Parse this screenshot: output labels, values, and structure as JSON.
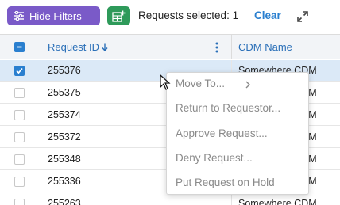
{
  "toolbar": {
    "hide_filters_label": "Hide Filters",
    "requests_selected_label": "Requests selected: 1",
    "clear_label": "Clear"
  },
  "grid": {
    "columns": [
      "Request ID",
      "CDM Name"
    ],
    "rows": [
      {
        "id": "255376",
        "cdm": "Somewhere CDM",
        "selected": true
      },
      {
        "id": "255375",
        "cdm": "Somewhere CDM",
        "selected": false
      },
      {
        "id": "255374",
        "cdm": "Somewhere CDM",
        "selected": false
      },
      {
        "id": "255372",
        "cdm": "Somewhere CDM",
        "selected": false
      },
      {
        "id": "255348",
        "cdm": "Somewhere CDM",
        "selected": false
      },
      {
        "id": "255336",
        "cdm": "Somewhere CDM",
        "selected": false
      },
      {
        "id": "255263",
        "cdm": "Somewhere CDM",
        "selected": false
      }
    ]
  },
  "context_menu": {
    "items": [
      "Move To...",
      "Return to Requestor...",
      "Approve Request...",
      "Deny Request...",
      "Put Request on Hold"
    ]
  },
  "colors": {
    "hide_filters_bg": "#7a5ac8",
    "add_button_bg": "#2e9a5a",
    "accent": "#2a7fcf",
    "selected_row_bg": "#dbe9f7"
  }
}
